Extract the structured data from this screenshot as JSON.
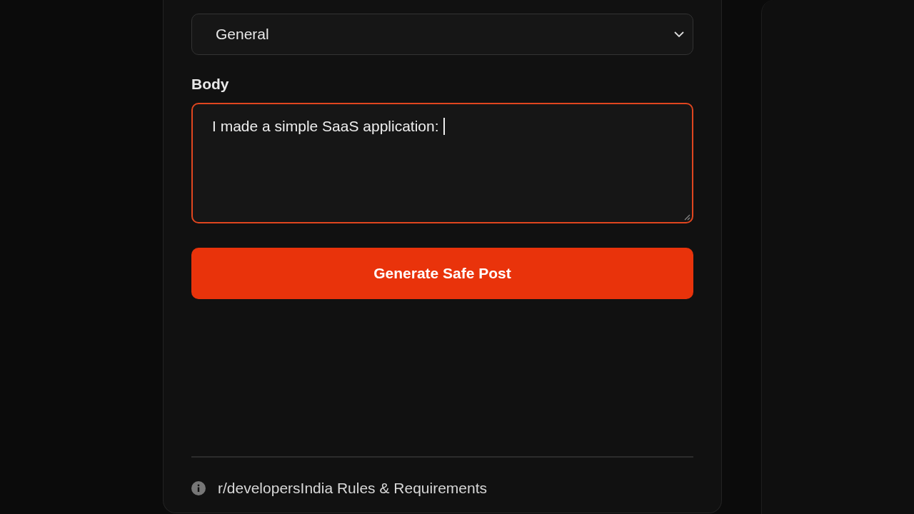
{
  "category_select": {
    "value": "General"
  },
  "body_field": {
    "label": "Body",
    "value": "I made a simple SaaS application:",
    "focused": true
  },
  "submit_button": {
    "label": "Generate Safe Post"
  },
  "rules_link": {
    "label": "r/developersIndia Rules & Requirements"
  }
}
